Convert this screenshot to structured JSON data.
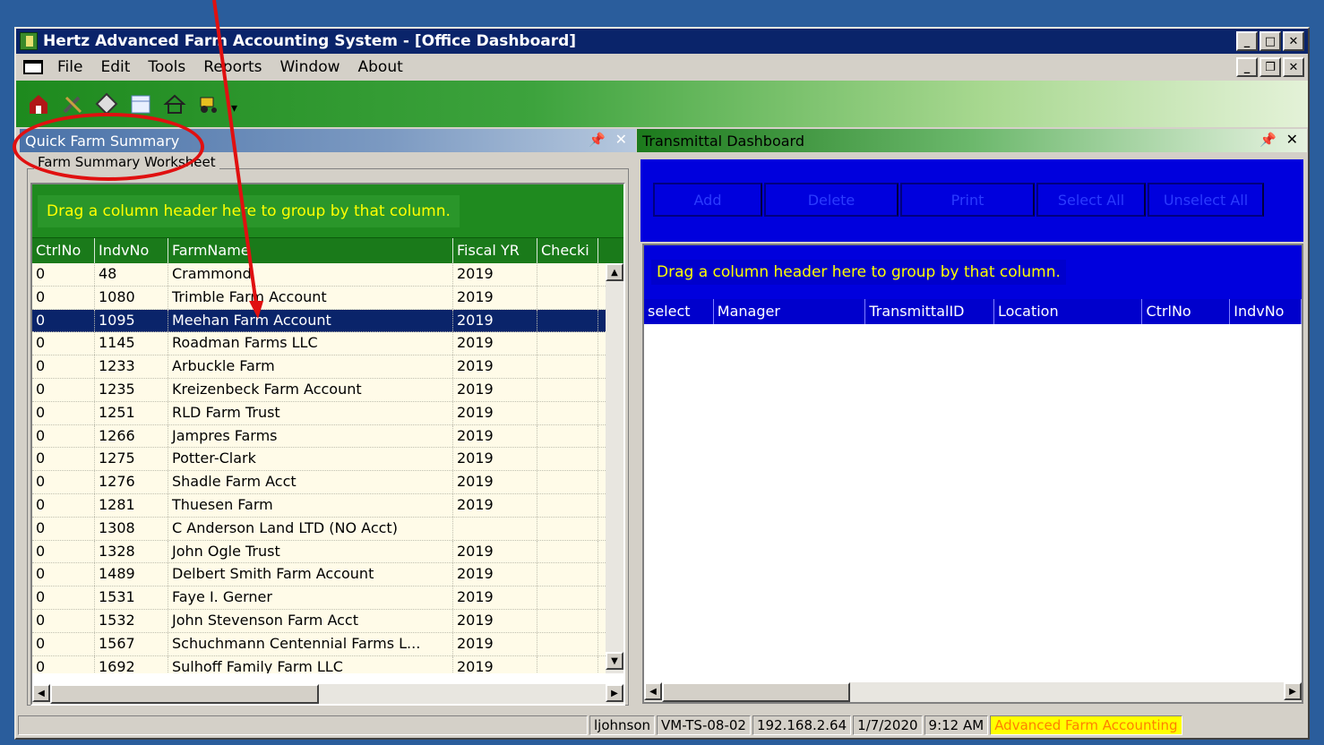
{
  "window": {
    "title": "Hertz Advanced Farm Accounting System - [Office Dashboard]"
  },
  "menu": {
    "items": [
      "File",
      "Edit",
      "Tools",
      "Reports",
      "Window",
      "About"
    ]
  },
  "toolbar": {
    "icons": [
      "barn-icon",
      "tools-icon",
      "tag-icon",
      "calendar-icon",
      "house-icon",
      "tractor-icon"
    ]
  },
  "left_panel": {
    "title": "Quick Farm Summary",
    "group_title": "Farm Summary Worksheet",
    "group_hint": "Drag a column header here to group by that column.",
    "columns": [
      "CtrlNo",
      "IndvNo",
      "FarmName",
      "Fiscal YR",
      "Checki"
    ],
    "rows": [
      [
        "0",
        "48",
        "Crammond",
        "2019",
        ""
      ],
      [
        "0",
        "1080",
        "Trimble Farm Account",
        "2019",
        ""
      ],
      [
        "0",
        "1095",
        "Meehan Farm Account",
        "2019",
        ""
      ],
      [
        "0",
        "1145",
        "Roadman Farms LLC",
        "2019",
        ""
      ],
      [
        "0",
        "1233",
        "Arbuckle Farm",
        "2019",
        ""
      ],
      [
        "0",
        "1235",
        "Kreizenbeck Farm Account",
        "2019",
        ""
      ],
      [
        "0",
        "1251",
        "RLD Farm Trust",
        "2019",
        ""
      ],
      [
        "0",
        "1266",
        "Jampres Farms",
        "2019",
        ""
      ],
      [
        "0",
        "1275",
        "Potter-Clark",
        "2019",
        ""
      ],
      [
        "0",
        "1276",
        "Shadle Farm Acct",
        "2019",
        ""
      ],
      [
        "0",
        "1281",
        "Thuesen Farm",
        "2019",
        ""
      ],
      [
        "0",
        "1308",
        "C Anderson Land LTD  (NO Acct)",
        "",
        ""
      ],
      [
        "0",
        "1328",
        "John Ogle Trust",
        "2019",
        ""
      ],
      [
        "0",
        "1489",
        "Delbert Smith Farm Account",
        "2019",
        ""
      ],
      [
        "0",
        "1531",
        "Faye I. Gerner",
        "2019",
        ""
      ],
      [
        "0",
        "1532",
        "John Stevenson Farm Acct",
        "2019",
        ""
      ],
      [
        "0",
        "1567",
        "Schuchmann  Centennial  Farms  L...",
        "2019",
        ""
      ],
      [
        "0",
        "1692",
        "Sulhoff Family Farm LLC",
        "2019",
        ""
      ]
    ],
    "selected_row": 2
  },
  "right_panel": {
    "title": "Transmittal Dashboard",
    "buttons": [
      "Add",
      "Delete",
      "Print",
      "Select All",
      "Unselect All"
    ],
    "group_hint": "Drag a column header here to group by that column.",
    "columns": [
      "select",
      "Manager",
      "TransmittalID",
      "Location",
      "CtrlNo",
      "IndvNo"
    ]
  },
  "status": {
    "user": "ljohnson",
    "machine": "VM-TS-08-02",
    "ip": "192.168.2.64",
    "date": "1/7/2020",
    "time": "9:12 AM",
    "app": "Advanced Farm Accounting"
  },
  "colors": {
    "title_bar": "#0a246a",
    "toolbar_green": "#1e8a1e",
    "grid_banner_green": "#1f8a1f",
    "transmittal_blue": "#0000dd",
    "hint_yellow": "#ffff00",
    "selected_row": "#0a246a",
    "annotation_red": "#e01010"
  }
}
